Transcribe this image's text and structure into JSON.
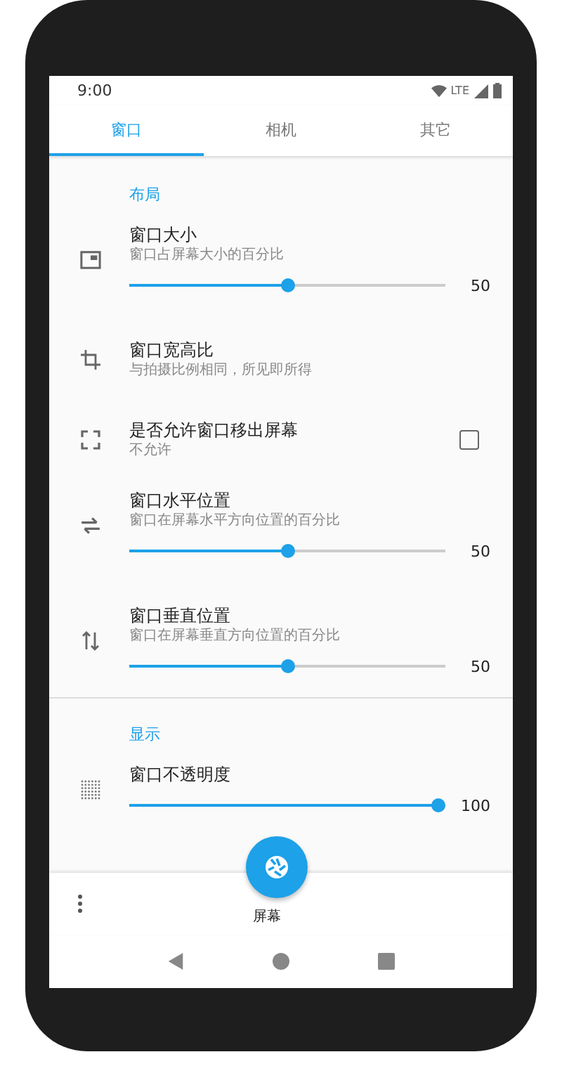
{
  "status_bar": {
    "time": "9:00",
    "network": "LTE"
  },
  "tabs": [
    {
      "label": "窗口",
      "selected": true
    },
    {
      "label": "相机",
      "selected": false
    },
    {
      "label": "其它",
      "selected": false
    }
  ],
  "sections": [
    {
      "title": "布局",
      "items": [
        {
          "kind": "slider",
          "title": "窗口大小",
          "subtitle": "窗口占屏幕大小的百分比",
          "level": 0.5,
          "value": "50"
        },
        {
          "kind": "text",
          "title": "窗口宽高比",
          "subtitle": "与拍摄比例相同，所见即所得"
        },
        {
          "kind": "checkbox",
          "title": "是否允许窗口移出屏幕",
          "subtitle": "不允许",
          "checked": false
        },
        {
          "kind": "slider",
          "title": "窗口水平位置",
          "subtitle": "窗口在屏幕水平方向位置的百分比",
          "level": 0.5,
          "value": "50"
        },
        {
          "kind": "slider",
          "title": "窗口垂直位置",
          "subtitle": "窗口在屏幕垂直方向位置的百分比",
          "level": 0.5,
          "value": "50"
        }
      ]
    },
    {
      "title": "显示",
      "items": [
        {
          "kind": "slider",
          "title": "窗口不透明度",
          "level": 1,
          "value": "100"
        }
      ]
    }
  ],
  "bottom_bar": {
    "label": "屏幕"
  }
}
